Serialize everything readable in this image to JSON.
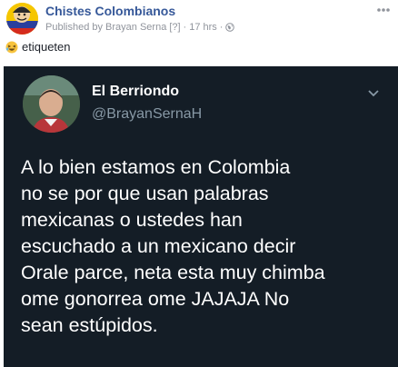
{
  "post": {
    "page_name": "Chistes Colombianos",
    "published_by": "Published by Brayan Serna",
    "badge": "[?]",
    "dot1": "·",
    "time": "17 hrs",
    "dot2": "·",
    "privacy_icon": "globe-icon",
    "more_icon": "ellipsis-icon",
    "caption_icon": "laughing-emoji-icon",
    "caption": "etiqueten"
  },
  "tweet": {
    "display_name": "El Berriondo",
    "handle": "@BrayanSernaH",
    "menu_icon": "chevron-down-icon",
    "lines": [
      "A lo bien estamos en Colombia",
      "no se por que usan palabras",
      "mexicanas o ustedes han",
      "escuchado a un mexicano decir",
      "Orale parce, neta esta muy chimba",
      "ome gonorrea ome JAJAJA No",
      "sean estúpidos."
    ]
  },
  "colors": {
    "link": "#365899",
    "meta": "#90949c",
    "tweet_bg": "#141d26",
    "tweet_handle": "#8899a6",
    "tweet_text": "#ffffff"
  }
}
